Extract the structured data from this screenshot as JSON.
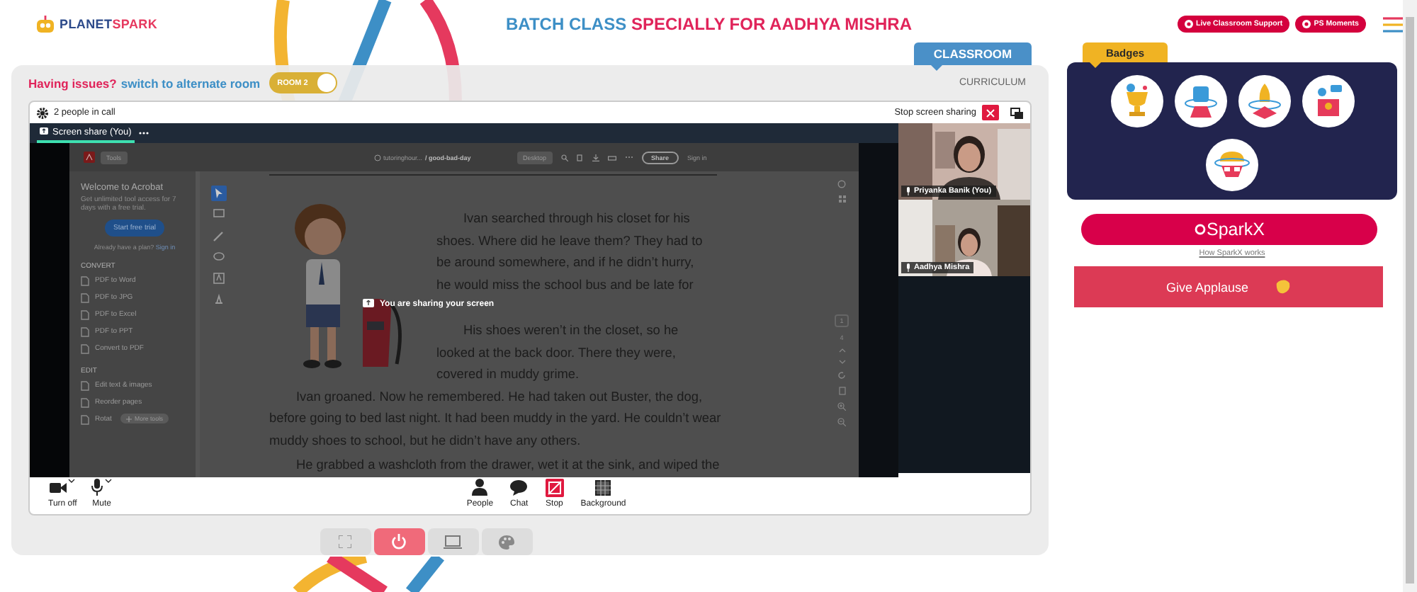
{
  "header": {
    "logo_lead": "PLANET",
    "logo_tail": "SPARK",
    "title_lead": "BATCH CLASS",
    "title_name": "SPECIALLY FOR AADHYA MISHRA",
    "actions": [
      {
        "label": "Live Classroom Support"
      },
      {
        "label": "PS Moments"
      }
    ]
  },
  "issue_bar": {
    "question": "Having issues?",
    "link": "switch to alternate room",
    "toggle_label": "ROOM 2",
    "on": true
  },
  "view_tabs": [
    {
      "label": "CLASSROOM",
      "selected": true
    },
    {
      "label": "CURRICULUM",
      "selected": false
    }
  ],
  "call": {
    "people_count": "2 people in call",
    "stop_sharing": "Stop screen sharing",
    "share_tab": "Screen share (You)",
    "sharing_notice": "You are sharing your screen",
    "participants": [
      {
        "name": "Priyanka Banik (You)"
      },
      {
        "name": "Aadhya Mishra"
      }
    ],
    "left_controls": [
      {
        "kind": "camera",
        "label": "Turn off"
      },
      {
        "kind": "mic",
        "label": "Mute"
      }
    ],
    "center_controls": [
      {
        "kind": "people",
        "label": "People"
      },
      {
        "kind": "chat",
        "label": "Chat"
      },
      {
        "kind": "stop",
        "label": "Stop"
      },
      {
        "kind": "background",
        "label": "Background"
      }
    ]
  },
  "shared_screen": {
    "toolbar": {
      "tools": "Tools",
      "path": "tutoringhour...",
      "file": "/ good-bad-day",
      "desktop": "Desktop",
      "share": "Share",
      "sign_in": "Sign in"
    },
    "panel": {
      "title": "Welcome to Acrobat",
      "text": "Get unlimited tool access for 7 days with a free trial.",
      "trial": "Start free trial",
      "plan": "Already have a plan?",
      "sign_in": "Sign in",
      "sections": [
        {
          "heading": "CONVERT",
          "items": [
            "PDF to Word",
            "PDF to JPG",
            "PDF to Excel",
            "PDF to PPT",
            "Convert to PDF"
          ]
        },
        {
          "heading": "EDIT",
          "items": [
            "Edit text & images",
            "Reorder pages",
            "Rotat"
          ]
        }
      ],
      "more": "More tools"
    },
    "page_current": "1",
    "page_total": "4",
    "story": [
      {
        "kind": "beside",
        "lines": [
          "Ivan searched through his closet for his",
          "shoes. Where did he leave them? They had to",
          "be around somewhere, and if he didn’t hurry,",
          "he would miss the school bus and be late for"
        ]
      },
      {
        "kind": "beside",
        "lines": [
          "His shoes weren’t in the closet, so he",
          "looked at the back door. There they were,",
          "covered in muddy grime."
        ]
      },
      {
        "kind": "full",
        "lines": [
          "Ivan groaned. Now he remembered. He had taken out Buster, the dog,",
          "before going to bed last night. It had been muddy in the yard. He couldn’t wear",
          "muddy shoes to school, but he didn’t have any others."
        ]
      },
      {
        "kind": "full",
        "lines": [
          "He grabbed a washcloth from the drawer, wet it at the sink, and wiped the"
        ]
      }
    ]
  },
  "bottom_buttons": [
    {
      "kind": "fullscreen"
    },
    {
      "kind": "power"
    },
    {
      "kind": "screen"
    },
    {
      "kind": "palette"
    }
  ],
  "badges": {
    "title": "Badges",
    "items": [
      {
        "kind": "trophy"
      },
      {
        "kind": "fist"
      },
      {
        "kind": "rocket"
      },
      {
        "kind": "podium"
      },
      {
        "kind": "brain"
      }
    ]
  },
  "sparkx": {
    "label": "SparkX",
    "help_link": "How SparkX works"
  },
  "applause": {
    "label": "Give Applause"
  }
}
